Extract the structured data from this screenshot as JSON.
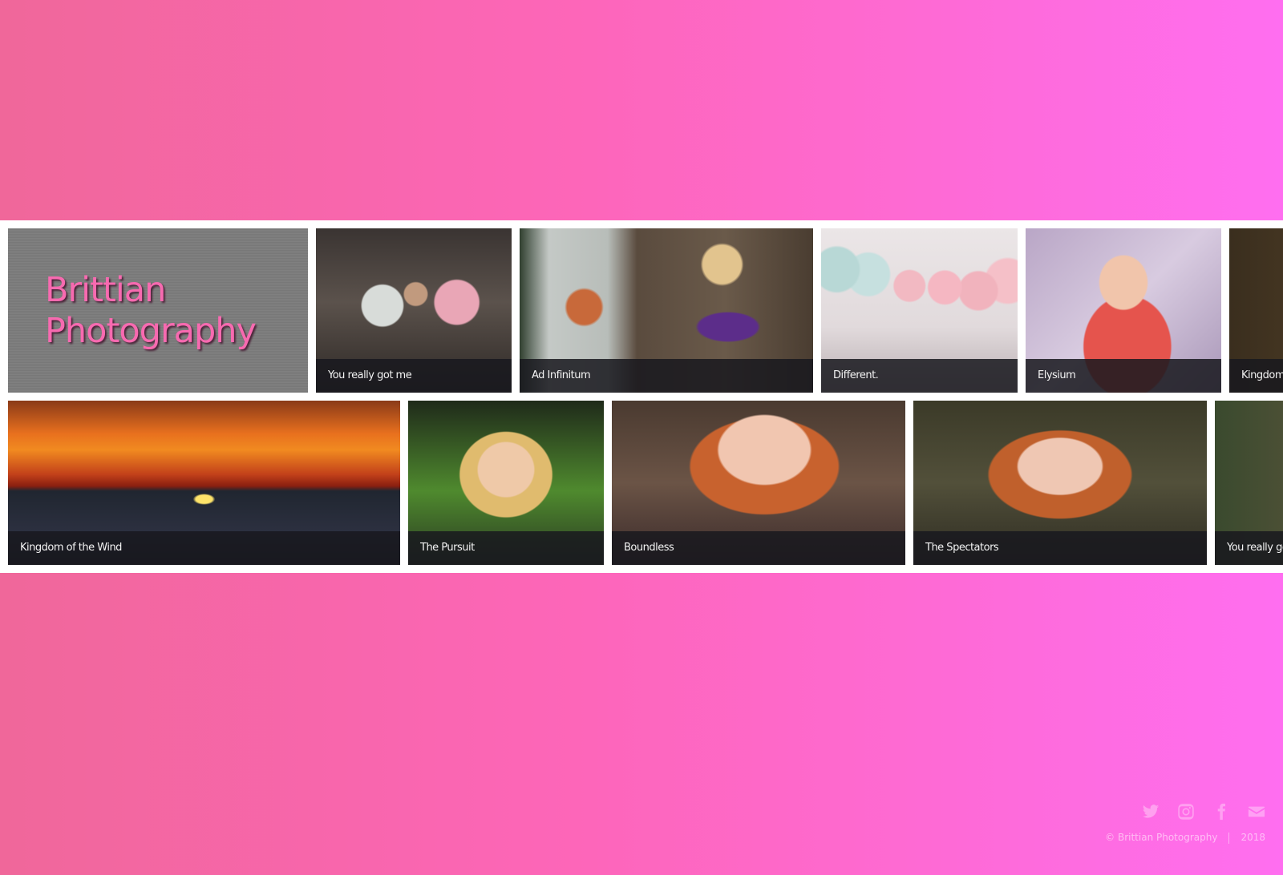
{
  "site": {
    "title": "Brittian Photography"
  },
  "gallery": {
    "row1": [
      {
        "caption": "You really got me"
      },
      {
        "caption": "Ad Infinitum"
      },
      {
        "caption": "Different."
      },
      {
        "caption": "Elysium"
      },
      {
        "caption": "Kingdom of the Wind"
      }
    ],
    "row2": [
      {
        "caption": "Kingdom of the Wind"
      },
      {
        "caption": "The Pursuit"
      },
      {
        "caption": "Boundless"
      },
      {
        "caption": "The Spectators"
      },
      {
        "caption": "You really got me"
      }
    ]
  },
  "footer": {
    "social_icons": [
      "twitter-icon",
      "instagram-icon",
      "facebook-icon",
      "envelope-icon"
    ],
    "copyright": "© Brittian Photography",
    "year": "2018"
  },
  "colors": {
    "background_gradient_start": "#f0679a",
    "background_gradient_end": "#ff6ef0",
    "title_pink": "#f76ab0",
    "title_tile_gray": "#7c7c7c"
  }
}
